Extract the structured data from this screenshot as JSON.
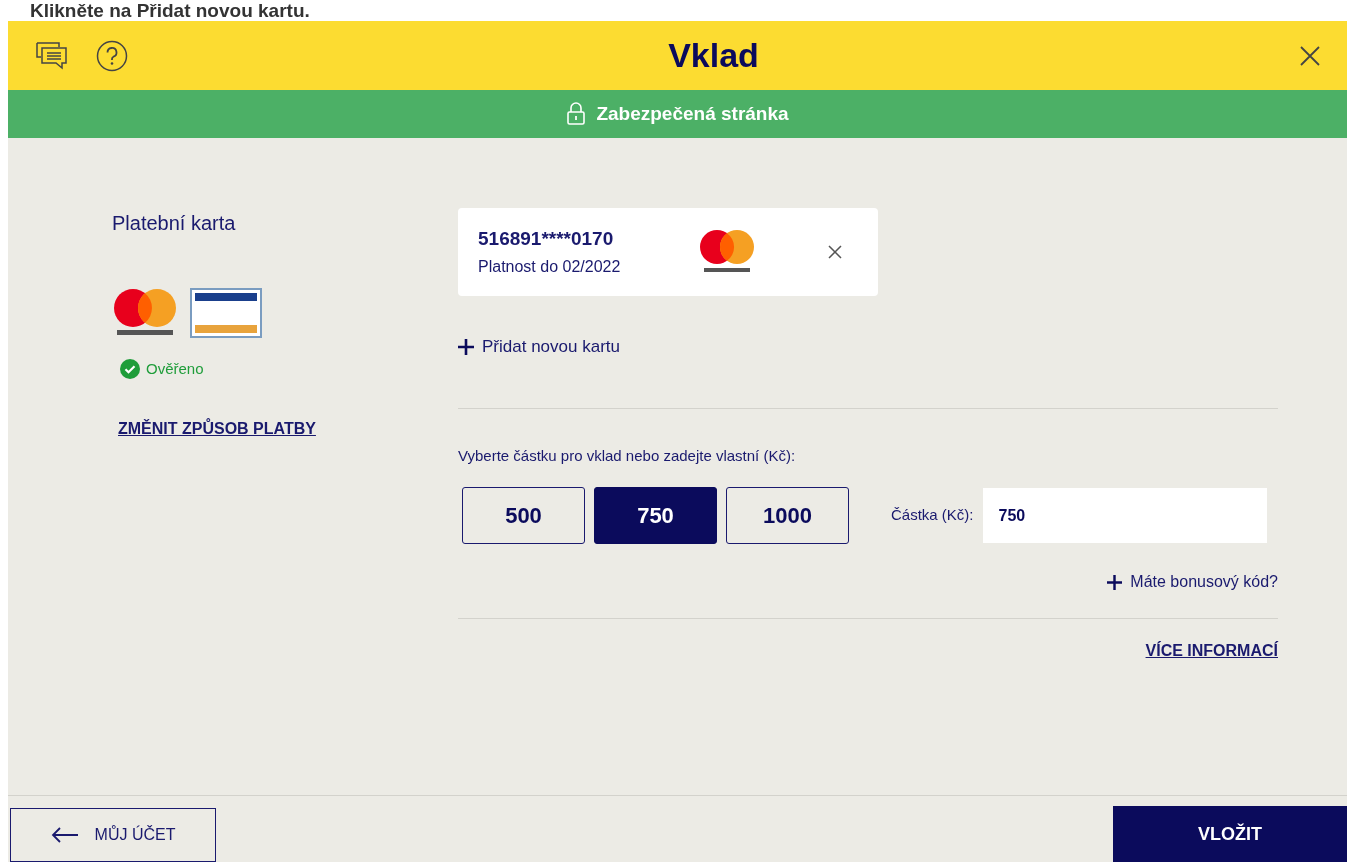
{
  "caption": "Klikněte na Přidat novou kartu.",
  "header": {
    "title": "Vklad"
  },
  "secure_bar": {
    "label": "Zabezpečená stránka"
  },
  "payment_method": {
    "title": "Platební karta",
    "status": "Ověřeno",
    "verified": true,
    "change_link": "ZMĚNIT ZPŮSOB PLATBY"
  },
  "saved_card": {
    "number": "516891****0170",
    "expiry": "Platnost do 02/2022"
  },
  "add_card": "Přidat novou kartu",
  "amount_prompt": "Vyberte částku pro vklad nebo zadejte vlastní (Kč):",
  "amounts": [
    {
      "label": "500",
      "selected": false
    },
    {
      "label": "750",
      "selected": true
    },
    {
      "label": "1000",
      "selected": false
    }
  ],
  "amount_field": {
    "label": "Částka (Kč):",
    "value": "750"
  },
  "bonus_code": "Máte bonusový kód?",
  "more_info": "VÍCE INFORMACÍ",
  "footer": {
    "back": "MŮJ ÚČET",
    "submit": "VLOŽIT"
  }
}
